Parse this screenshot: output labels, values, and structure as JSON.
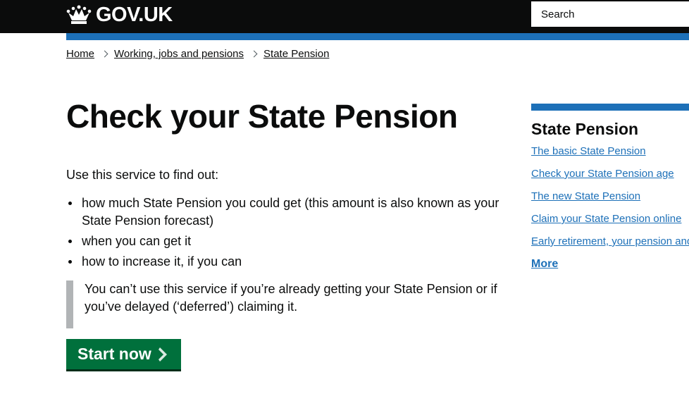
{
  "header": {
    "logo_text": "GOV.UK",
    "search_placeholder": "Search",
    "colors": {
      "background": "#0b0c0c",
      "accent_bar": "#1d70b8"
    }
  },
  "breadcrumb": [
    {
      "label": "Home"
    },
    {
      "label": "Working, jobs and pensions"
    },
    {
      "label": "State Pension"
    }
  ],
  "main": {
    "title": "Check your State Pension",
    "intro": "Use this service to find out:",
    "bullets": [
      "how much State Pension you could get (this amount is also known as your State Pension forecast)",
      "when you can get it",
      "how to increase it, if you can"
    ],
    "inset_text": "You can’t use this service if you’re already getting your State Pension or if you’ve delayed (‘deferred’) claiming it.",
    "start_button": {
      "label": "Start now",
      "icon": "chevron-right-icon",
      "color": "#00703c"
    }
  },
  "related": {
    "title": "State Pension",
    "links": [
      "The basic State Pension",
      "Check your State Pension age",
      "The new State Pension",
      "Claim your State Pension online",
      "Early retirement, your pension and benefits"
    ],
    "more_label": "More",
    "link_color": "#1d70b8"
  }
}
